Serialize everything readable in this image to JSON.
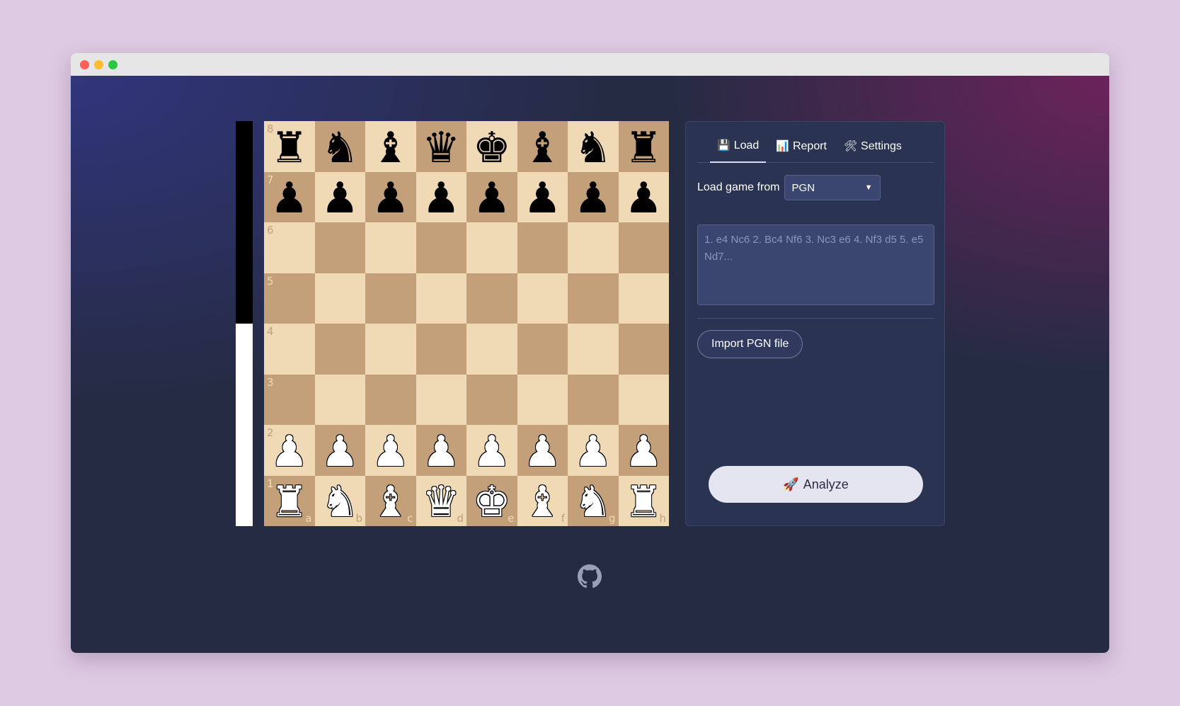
{
  "evalbar": {
    "black_fraction": 0.5
  },
  "board": {
    "files": [
      "a",
      "b",
      "c",
      "d",
      "e",
      "f",
      "g",
      "h"
    ],
    "ranks": [
      "8",
      "7",
      "6",
      "5",
      "4",
      "3",
      "2",
      "1"
    ],
    "position": [
      [
        "bR",
        "bN",
        "bB",
        "bQ",
        "bK",
        "bB",
        "bN",
        "bR"
      ],
      [
        "bP",
        "bP",
        "bP",
        "bP",
        "bP",
        "bP",
        "bP",
        "bP"
      ],
      [
        "",
        "",
        "",
        "",
        "",
        "",
        "",
        ""
      ],
      [
        "",
        "",
        "",
        "",
        "",
        "",
        "",
        ""
      ],
      [
        "",
        "",
        "",
        "",
        "",
        "",
        "",
        ""
      ],
      [
        "",
        "",
        "",
        "",
        "",
        "",
        "",
        ""
      ],
      [
        "wP",
        "wP",
        "wP",
        "wP",
        "wP",
        "wP",
        "wP",
        "wP"
      ],
      [
        "wR",
        "wN",
        "wB",
        "wQ",
        "wK",
        "wB",
        "wN",
        "wR"
      ]
    ],
    "colors": {
      "light": "#f0d9b5",
      "dark": "#c4a07a"
    }
  },
  "panel": {
    "tabs": [
      {
        "icon": "💾",
        "label": "Load",
        "active": true
      },
      {
        "icon": "📊",
        "label": "Report",
        "active": false
      },
      {
        "icon": "🛠",
        "label": "Settings",
        "active": false
      }
    ],
    "load_label": "Load game from",
    "source_select": {
      "value": "PGN"
    },
    "pgn_placeholder": "1. e4 Nc6 2. Bc4 Nf6 3. Nc3 e6 4. Nf3 d5 5. e5 Nd7...",
    "import_button": "Import PGN file",
    "analyze_button": {
      "icon": "🚀",
      "label": "Analyze"
    }
  },
  "footer": {
    "icon": "github-icon"
  }
}
